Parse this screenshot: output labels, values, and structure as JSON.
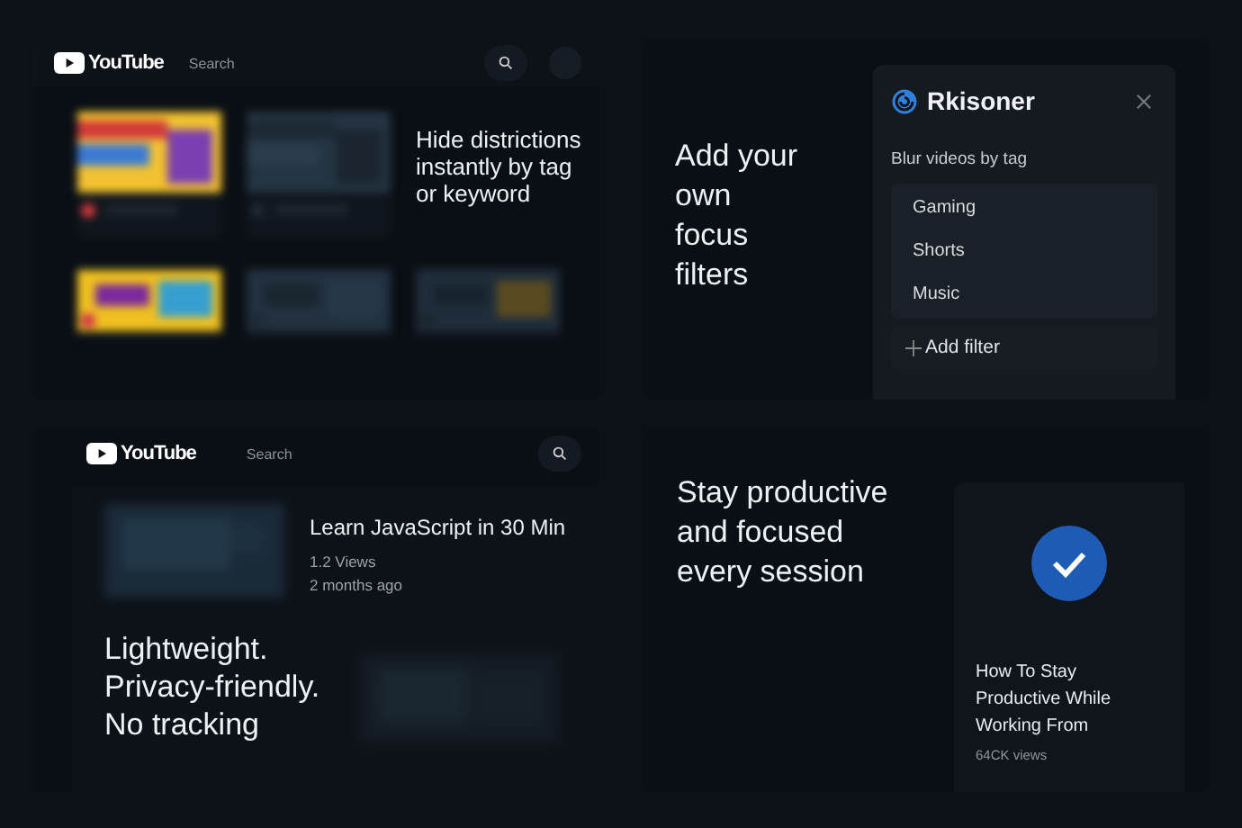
{
  "panels": [
    {
      "kind": "feed",
      "logo": "YouTube",
      "search": {
        "placeholder": "Search"
      },
      "caption": "Hide districtions\ninstantly by tag\nor keyword"
    },
    {
      "kind": "filters",
      "caption": "Add your\nown\nfocus\nfilters",
      "popup": {
        "title": "Rkisoner",
        "section": "Blur videos by tag",
        "tags": [
          "Gaming",
          "Shorts",
          "Music"
        ],
        "add_button": "Add filter"
      }
    },
    {
      "kind": "video",
      "logo": "YouTube",
      "search": {
        "placeholder": "Search"
      },
      "video": {
        "title": "Learn JavaScript in 30 Min",
        "views": "1.2 Views",
        "age": "2 months ago"
      },
      "caption": "Lightweight.\nPrivacy-friendly.\nNo tracking"
    },
    {
      "kind": "card",
      "caption": "Stay productive\nand focused\nevery session",
      "card": {
        "title": "How To Stay Productive While Working From",
        "views": "64CK views",
        "checked": true
      }
    }
  ]
}
